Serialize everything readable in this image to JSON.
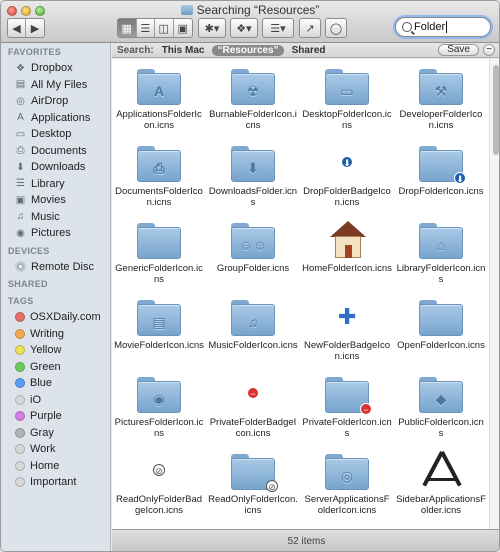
{
  "window": {
    "title": "Searching “Resources”"
  },
  "toolbar": {
    "back_icon": "chevron-left-icon",
    "forward_icon": "chevron-right-icon",
    "view_modes": [
      "icon-view",
      "list-view",
      "column-view",
      "coverflow-view"
    ],
    "action_label": "✱▾",
    "dropbox_label": "❖▾",
    "arrange_label": "☰▾",
    "share_label": "↗",
    "tag_label": "◯"
  },
  "search": {
    "value": "Folder"
  },
  "scope": {
    "label": "Search:",
    "options": [
      "This Mac",
      "“Resources”",
      "Shared"
    ],
    "selected": 1,
    "save_label": "Save",
    "remove_label": "−"
  },
  "sidebar": {
    "favorites_header": "FAVORITES",
    "favorites": [
      {
        "label": "Dropbox",
        "icon": "dropbox-icon"
      },
      {
        "label": "All My Files",
        "icon": "all-files-icon"
      },
      {
        "label": "AirDrop",
        "icon": "airdrop-icon"
      },
      {
        "label": "Applications",
        "icon": "applications-icon"
      },
      {
        "label": "Desktop",
        "icon": "desktop-icon"
      },
      {
        "label": "Documents",
        "icon": "documents-icon"
      },
      {
        "label": "Downloads",
        "icon": "downloads-icon"
      },
      {
        "label": "Library",
        "icon": "library-icon"
      },
      {
        "label": "Movies",
        "icon": "movies-icon"
      },
      {
        "label": "Music",
        "icon": "music-icon"
      },
      {
        "label": "Pictures",
        "icon": "pictures-icon"
      }
    ],
    "devices_header": "DEVICES",
    "devices": [
      {
        "label": "Remote Disc",
        "icon": "remote-disc-icon"
      }
    ],
    "shared_header": "SHARED",
    "tags_header": "TAGS",
    "tags": [
      {
        "label": "OSXDaily.com",
        "color": "#e56d6b"
      },
      {
        "label": "Writing",
        "color": "#f1a94e"
      },
      {
        "label": "Yellow",
        "color": "#ece159"
      },
      {
        "label": "Green",
        "color": "#6bcb5d"
      },
      {
        "label": "Blue",
        "color": "#5a9ef0"
      },
      {
        "label": "iO",
        "color": "#d7d7d7"
      },
      {
        "label": "Purple",
        "color": "#d27ee3"
      },
      {
        "label": "Gray",
        "color": "#b3b3b3"
      },
      {
        "label": "Work",
        "color": "#d7d7d7"
      },
      {
        "label": "Home",
        "color": "#d7d7d7"
      },
      {
        "label": "Important",
        "color": "#d7d7d7"
      }
    ]
  },
  "files": [
    {
      "name": "ApplicationsFolderIcon.icns",
      "kind": "folder",
      "emblem": "A"
    },
    {
      "name": "BurnableFolderIcon.icns",
      "kind": "folder",
      "emblem": "☢"
    },
    {
      "name": "DesktopFolderIcon.icns",
      "kind": "folder",
      "emblem": "▭"
    },
    {
      "name": "DeveloperFolderIcon.icns",
      "kind": "folder",
      "emblem": "⚒"
    },
    {
      "name": "DocumentsFolderIcon.icns",
      "kind": "folder",
      "emblem": "⎙"
    },
    {
      "name": "DownloadsFolder.icns",
      "kind": "folder",
      "emblem": "⬇"
    },
    {
      "name": "DropFolderBadgeIcon.icns",
      "kind": "badge",
      "emblem": "⬇",
      "badge": "down"
    },
    {
      "name": "DropFolderIcon.icns",
      "kind": "folder",
      "emblem": "",
      "badge": "down"
    },
    {
      "name": "GenericFolderIcon.icns",
      "kind": "folder",
      "emblem": ""
    },
    {
      "name": "GroupFolder.icns",
      "kind": "folder",
      "emblem": "☺☺"
    },
    {
      "name": "HomeFolderIcon.icns",
      "kind": "house",
      "emblem": ""
    },
    {
      "name": "LibraryFolderIcon.icns",
      "kind": "folder",
      "emblem": "⌂"
    },
    {
      "name": "MovieFolderIcon.icns",
      "kind": "folder",
      "emblem": "▤"
    },
    {
      "name": "MusicFolderIcon.icns",
      "kind": "folder",
      "emblem": "♫"
    },
    {
      "name": "NewFolderBadgeIcon.icns",
      "kind": "plus",
      "emblem": "✚"
    },
    {
      "name": "OpenFolderIcon.icns",
      "kind": "folder",
      "emblem": ""
    },
    {
      "name": "PicturesFolderIcon.icns",
      "kind": "folder",
      "emblem": "◉"
    },
    {
      "name": "PrivateFolderBadgeIcon.icns",
      "kind": "badge",
      "emblem": "−",
      "badge": "red"
    },
    {
      "name": "PrivateFolderIcon.icns",
      "kind": "folder",
      "emblem": "",
      "badge": "red"
    },
    {
      "name": "PublicFolderIcon.icns",
      "kind": "folder",
      "emblem": "◆"
    },
    {
      "name": "ReadOnlyFolderBadgeIcon.icns",
      "kind": "badge",
      "emblem": "⊘",
      "badge": "noentry"
    },
    {
      "name": "ReadOnlyFolderIcon.icns",
      "kind": "folder",
      "emblem": "",
      "badge": "noentry"
    },
    {
      "name": "ServerApplicationsFolderIcon.icns",
      "kind": "folder",
      "emblem": "◎"
    },
    {
      "name": "SidebarApplicationsFolder.icns",
      "kind": "tools",
      "emblem": ""
    }
  ],
  "status": {
    "text": "52 items"
  }
}
